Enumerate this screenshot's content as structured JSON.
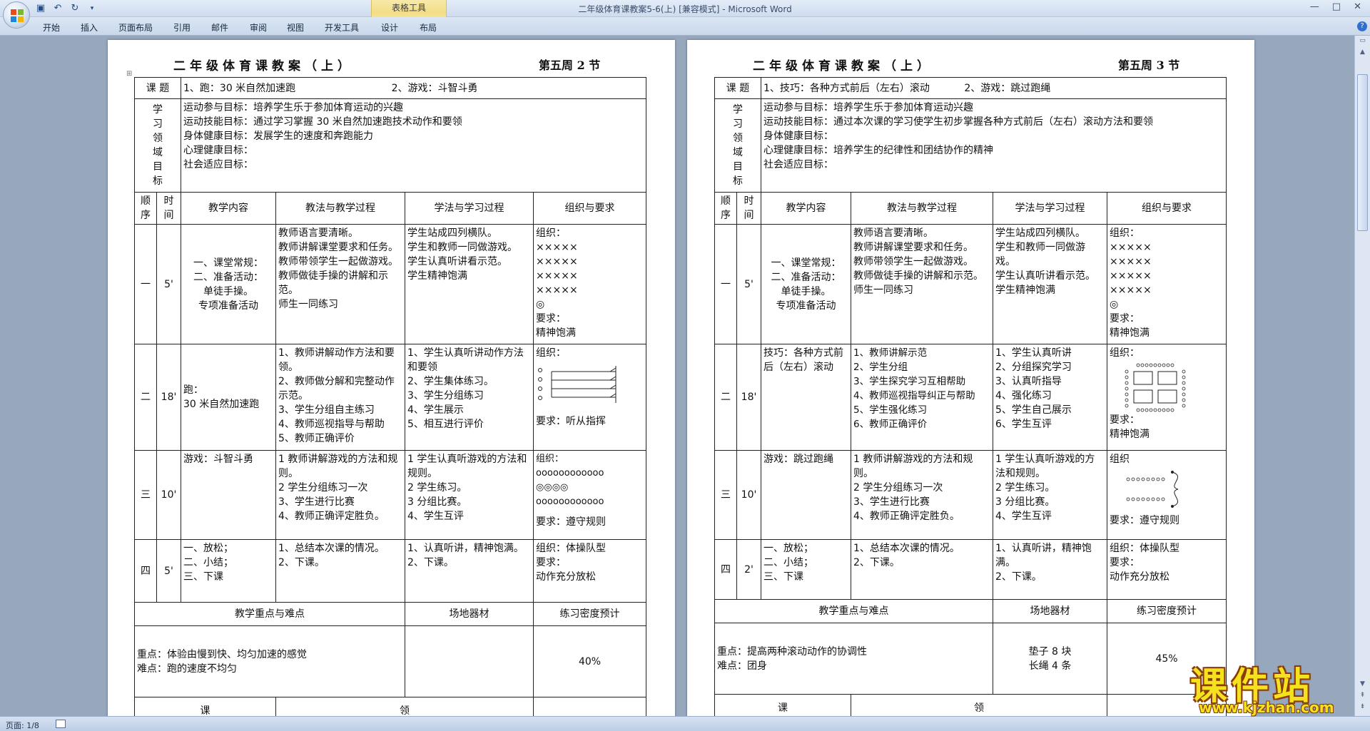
{
  "window": {
    "title": "二年级体育课教案5-6(上) [兼容模式] - Microsoft Word",
    "context_tab_group": "表格工具",
    "help_icon": "help-icon"
  },
  "ribbon": {
    "tabs": [
      "开始",
      "插入",
      "页面布局",
      "引用",
      "邮件",
      "审阅",
      "视图",
      "开发工具",
      "设计",
      "布局"
    ]
  },
  "status": {
    "page": "页面: 1/8"
  },
  "watermark": {
    "big": "课件站",
    "url": "www.kjzhan.com"
  },
  "pages": [
    {
      "title": "二年级体育课教案（上）",
      "week": "第五周 2 节",
      "topic_label": "课 题",
      "topic_1": "1、跑：30 米自然加速跑",
      "topic_2": "2、游戏：斗智斗勇",
      "goals_label": "学\n习\n领\n域\n目\n标",
      "goals": "运动参与目标：培养学生乐于参加体育运动的兴趣\n运动技能目标：通过学习掌握 30 米自然加速跑技术动作和要领\n身体健康目标：发展学生的速度和奔跑能力\n心理健康目标：\n社会适应目标：",
      "head": {
        "seq": "顺序",
        "time": "时间",
        "content": "教学内容",
        "teach": "教法与教学过程",
        "learn": "学法与学习过程",
        "org": "组织与要求"
      },
      "rows": [
        {
          "seq": "一",
          "time": "5'",
          "content": "一、课堂常规：\n二、准备活动：\n单徒手操。\n专项准备活动",
          "teach": "教师语言要清晰。\n教师讲解课堂要求和任务。\n教师带领学生一起做游戏。\n教师做徒手操的讲解和示范。\n师生一同练习",
          "learn": "学生站成四列横队。\n学生和教师一同做游戏。\n学生认真听讲看示范。\n学生精神饱满",
          "org_top": "组织：\n×××××\n×××××\n×××××\n×××××\n◎",
          "org_bottom": "要求：\n精神饱满"
        },
        {
          "seq": "二",
          "time": "18'",
          "content": "跑：\n30 米自然加速跑",
          "teach": "1、教师讲解动作方法和要领。\n2、教师做分解和完整动作示范。\n3、学生分组自主练习\n4、教师巡视指导与帮助\n5、教师正确评价",
          "learn": "1、学生认真听讲动作方法和要领\n2、学生集体练习。\n3、学生分组练习\n4、学生展示\n5、相互进行评价",
          "org_top": "组织：",
          "org_bottom": "要求：听从指挥"
        },
        {
          "seq": "三",
          "time": "10'",
          "content": "游戏：斗智斗勇",
          "teach": "1 教师讲解游戏的方法和规则。\n2 学生分组练习一次\n3、学生进行比赛\n4、教师正确评定胜负。",
          "learn": "1 学生认真听游戏的方法和规则。\n2 学生练习。\n3 分组比赛。\n4、学生互评",
          "org_top": "组织：\noooooooooooo\n◎◎◎◎\noooooooooooo",
          "org_bottom": "要求：遵守规则"
        },
        {
          "seq": "四",
          "time": "5'",
          "content": "一、放松；\n二、小结；\n三、下课",
          "teach": "1、总结本次课的情况。\n2、下课。",
          "learn": "1、认真听讲，精神饱满。\n2、下课。",
          "org_top": "组织：体操队型\n要求：\n    动作充分放松",
          "org_bottom": ""
        }
      ],
      "summary_head": {
        "key": "教学重点与难点",
        "equip": "场地器材",
        "density": "练习密度预计"
      },
      "summary": {
        "key": "重点：体验由慢到快、均匀加速的感觉\n难点：跑的速度不均匀",
        "equip": "",
        "density": "40%"
      },
      "foot": {
        "a": "课",
        "b": "领"
      }
    },
    {
      "title": "二年级体育课教案（上）",
      "week": "第五周 3 节",
      "topic_label": "课 题",
      "topic_1": "1、技巧：各种方式前后（左右）滚动",
      "topic_2": "2、游戏：跳过跑绳",
      "goals_label": "学\n习\n领\n域\n目\n标",
      "goals": "运动参与目标：培养学生乐于参加体育运动兴趣\n运动技能目标：通过本次课的学习使学生初步掌握各种方式前后（左右）滚动方法和要领\n身体健康目标：\n心理健康目标：培养学生的纪律性和团结协作的精神\n社会适应目标：",
      "head": {
        "seq": "顺序",
        "time": "时间",
        "content": "教学内容",
        "teach": "教法与教学过程",
        "learn": "学法与学习过程",
        "org": "组织与要求"
      },
      "rows": [
        {
          "seq": "一",
          "time": "5'",
          "content": "一、课堂常规：\n二、准备活动：\n单徒手操。\n专项准备活动",
          "teach": "教师语言要清晰。\n教师讲解课堂要求和任务。\n教师带领学生一起做游戏。\n教师做徒手操的讲解和示范。\n师生一同练习",
          "learn": "学生站成四列横队。\n学生和教师一同做游戏。\n学生认真听讲看示范。\n学生精神饱满",
          "org_top": "组织：\n×××××\n×××××\n×××××\n×××××\n◎",
          "org_bottom": "要求：\n精神饱满"
        },
        {
          "seq": "二",
          "time": "18'",
          "content": "技巧：各种方式前后（左右）滚动",
          "teach": "1、教师讲解示范\n2、学生分组\n3、学生探究学习互相帮助\n4、教师巡视指导纠正与帮助\n5、学生强化练习\n6、教师正确评价",
          "learn": "1、学生认真听讲\n2、分组探究学习\n3、认真听指导\n4、强化练习\n5、学生自己展示\n6、学生互评",
          "org_top": "组织：",
          "org_bottom": "要求：\n精神饱满"
        },
        {
          "seq": "三",
          "time": "10'",
          "content": "游戏：跳过跑绳",
          "teach": "1 教师讲解游戏的方法和规则。\n2 学生分组练习一次\n3、学生进行比赛\n4、教师正确评定胜负。",
          "learn": "1 学生认真听游戏的方法和规则。\n2 学生练习。\n3 分组比赛。\n4、学生互评",
          "org_top": "组织",
          "org_bottom": "要求：遵守规则"
        },
        {
          "seq": "四",
          "time": "2'",
          "content": "一、放松；\n二、小结；\n三、下课",
          "teach": "1、总结本次课的情况。\n2、下课。",
          "learn": "1、认真听讲，精神饱满。\n2、下课。",
          "org_top": "组织：体操队型\n要求：\n动作充分放松",
          "org_bottom": ""
        }
      ],
      "summary_head": {
        "key": "教学重点与难点",
        "equip": "场地器材",
        "density": "练习密度预计"
      },
      "summary": {
        "key": "重点：提高两种滚动动作的协调性\n难点：团身",
        "equip": "垫子 8 块\n长绳 4 条",
        "density": "45%"
      },
      "foot": {
        "a": "课",
        "b": "领"
      }
    }
  ]
}
